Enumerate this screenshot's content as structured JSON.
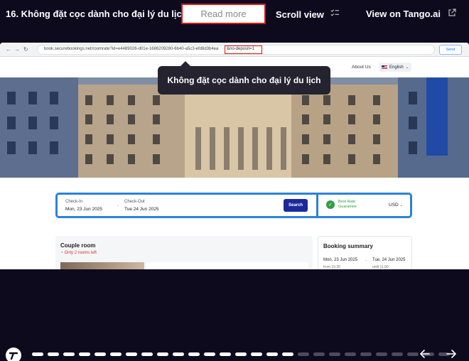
{
  "header": {
    "step_title": "16. Không đặt cọc dành cho đại lý du lịch",
    "read_more": "Read more",
    "scroll_view": "Scroll view",
    "view_on_tango": "View on Tango.ai"
  },
  "browser": {
    "url_text": "book.securebookings.net/roomrate?id=e4489026-d01e-1686209280-6b40-a5c3-efd8d3b4ea",
    "url_highlight": "&no-deposit=1",
    "ext_button": "Send"
  },
  "site": {
    "about_link": "About Us",
    "language": "English"
  },
  "tooltip": {
    "text": "Không đặt cọc dành cho đại lý du lịch"
  },
  "search": {
    "checkin_label": "Check-In",
    "checkin_value": "Mon, 23 Jun 2025",
    "dash": "-",
    "checkout_label": "Check-Out",
    "checkout_value": "Tue 24 Jun 2025",
    "search_button": "Search",
    "best_rate_line1": "Best Rate",
    "best_rate_line2": "Guarantee",
    "currency": "USD"
  },
  "room": {
    "title": "Couple room",
    "availability": "Only 2 rooms left"
  },
  "booking_summary": {
    "title": "Booking summary",
    "checkin_date": "Mon, 23 Jun 2025",
    "arrow": "→",
    "checkout_date": "Tue, 24 Jun 2025",
    "from_time": "from 15:30",
    "until_time": "until 11:00"
  },
  "progress": {
    "total_steps": 27,
    "current_step": 17
  },
  "icons": {
    "scroll_view": "checklist-icon",
    "external": "external-link-icon",
    "prev": "arrow-left-icon",
    "next": "arrow-right-icon"
  },
  "colors": {
    "background": "#0d0a1e",
    "highlight_border": "#e01414",
    "search_border": "#2a83d8",
    "search_button": "#1b2a9a",
    "best_rate": "#2ea043"
  }
}
